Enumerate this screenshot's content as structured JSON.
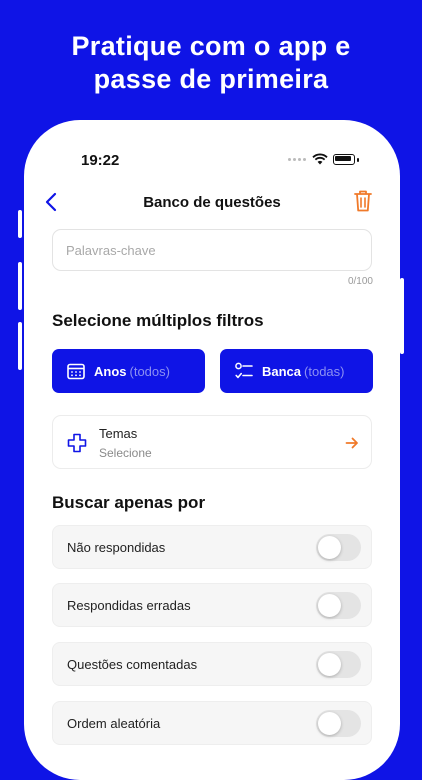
{
  "headline": {
    "line1": "Pratique com o app e",
    "line2": "passe de primeira"
  },
  "status_bar": {
    "time": "19:22"
  },
  "nav": {
    "title": "Banco de questões",
    "back_icon": "chevron-left-icon",
    "trash_icon": "trash-icon"
  },
  "search": {
    "placeholder": "Palavras-chave",
    "value": "",
    "counter": "0/100"
  },
  "filters": {
    "heading": "Selecione múltiplos filtros",
    "anos": {
      "label": "Anos",
      "value": "(todos)"
    },
    "banca": {
      "label": "Banca",
      "value": "(todas)"
    }
  },
  "temas": {
    "label": "Temas",
    "sub": "Selecione"
  },
  "options": {
    "heading": "Buscar apenas por",
    "items": [
      {
        "label": "Não respondidas",
        "on": false
      },
      {
        "label": "Respondidas erradas",
        "on": false
      },
      {
        "label": "Questões comentadas",
        "on": false
      },
      {
        "label": "Ordem aleatória",
        "on": false
      }
    ]
  },
  "colors": {
    "brand": "#0f14e6",
    "accent": "#f07a2a"
  }
}
